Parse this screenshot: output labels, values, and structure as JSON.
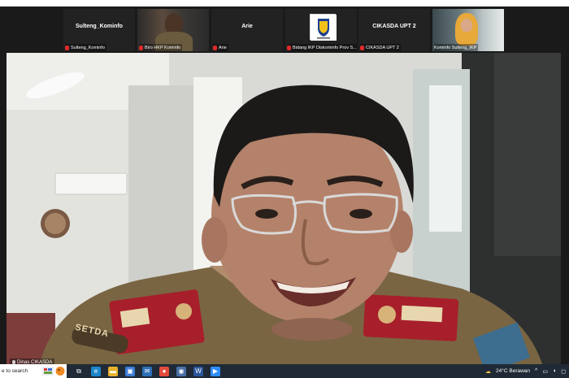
{
  "participants": [
    {
      "tile_name": "Sulteng_Kominfo",
      "label": "Sulteng_Kominfo",
      "muted": true,
      "video": false
    },
    {
      "tile_name": "",
      "label": "Biro HKP Kominfo",
      "muted": true,
      "video": true
    },
    {
      "tile_name": "Arie",
      "label": "Arie",
      "muted": true,
      "video": false
    },
    {
      "tile_name": "",
      "label": "Bidang IKP Diskominfo Prov S...",
      "muted": true,
      "video": false,
      "logo": true
    },
    {
      "tile_name": "CIKASDA UPT 2",
      "label": "CIKASDA UPT 2",
      "muted": true,
      "video": false
    },
    {
      "tile_name": "",
      "label": "Kominfo Sulteng_IKP",
      "muted": false,
      "video": true
    }
  ],
  "main_speaker": {
    "label": "Dinas CIKASDA",
    "badge_text": "SETDA"
  },
  "taskbar": {
    "search_placeholder": "e to search",
    "apps": [
      {
        "icon": "task-view-icon",
        "symbol": "⧉",
        "color": "#1f2a36"
      },
      {
        "icon": "edge-icon",
        "symbol": "e",
        "color": "#1b86c8"
      },
      {
        "icon": "file-explorer-icon",
        "symbol": "▬",
        "color": "#e6b32e"
      },
      {
        "icon": "store-icon",
        "symbol": "▣",
        "color": "#3a7bd5"
      },
      {
        "icon": "mail-icon",
        "symbol": "✉",
        "color": "#2d6fb7"
      },
      {
        "icon": "chrome-icon",
        "symbol": "●",
        "color": "#e24b3b"
      },
      {
        "icon": "people-icon",
        "symbol": "◉",
        "color": "#4a6fa5"
      },
      {
        "icon": "word-icon",
        "symbol": "W",
        "color": "#2b579a"
      },
      {
        "icon": "zoom-icon",
        "symbol": "▶",
        "color": "#2d8cff"
      }
    ],
    "weather": "24°C  Berawan",
    "tray_chevron": "^",
    "tray_icons": [
      "network-icon",
      "speaker-icon",
      "notification-icon"
    ],
    "tray_symbols": [
      "▭",
      "◖",
      "◻"
    ]
  }
}
